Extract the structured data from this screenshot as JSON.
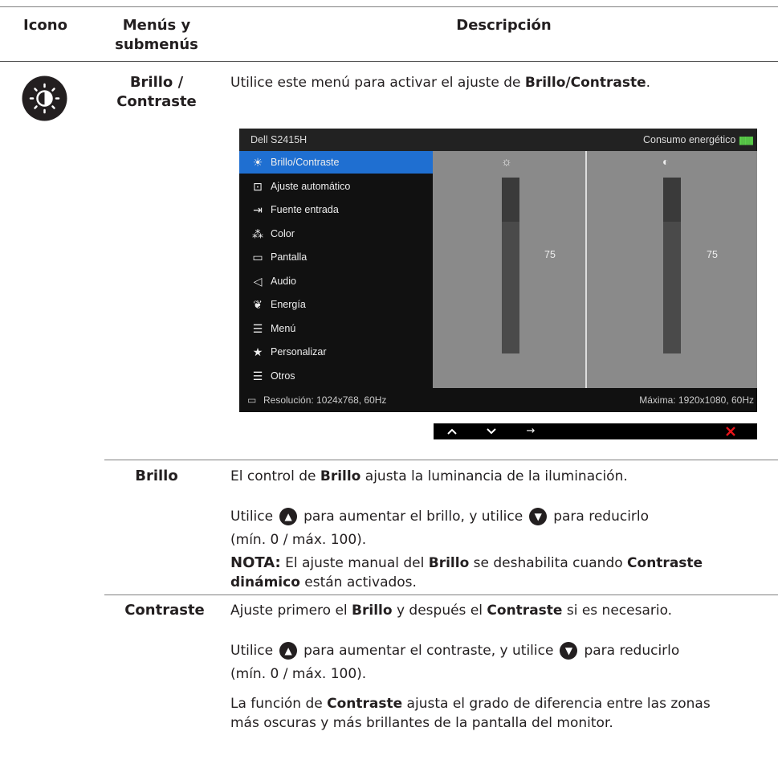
{
  "headers": {
    "icon": "Icono",
    "menus_line1": "Menús y",
    "menus_line2": "submenús",
    "description": "Descripción"
  },
  "main_row": {
    "menu_label_line1": "Brillo /",
    "menu_label_line2": "Contraste",
    "intro_pre": "Utilice este menú para activar el ajuste de ",
    "intro_bold": "Brillo/Contraste",
    "intro_post": "."
  },
  "osd": {
    "model": "Dell S2415H",
    "energy_label": "Consumo energético",
    "energy_meter": "||||||||||||||||||||",
    "menu_items": [
      {
        "icon": "brightness-icon",
        "label": "Brillo/Contraste",
        "selected": true
      },
      {
        "icon": "auto-adjust-icon",
        "label": "Ajuste  automático",
        "selected": false
      },
      {
        "icon": "input-source-icon",
        "label": "Fuente entrada",
        "selected": false
      },
      {
        "icon": "color-icon",
        "label": "Color",
        "selected": false
      },
      {
        "icon": "display-icon",
        "label": "Pantalla",
        "selected": false
      },
      {
        "icon": "audio-icon",
        "label": "Audio",
        "selected": false
      },
      {
        "icon": "energy-icon",
        "label": "Energía",
        "selected": false
      },
      {
        "icon": "menu-icon",
        "label": "Menú",
        "selected": false
      },
      {
        "icon": "star-icon",
        "label": "Personalizar",
        "selected": false
      },
      {
        "icon": "others-icon",
        "label": "Otros",
        "selected": false
      }
    ],
    "brightness_value": "75",
    "contrast_value": "75",
    "brightness_level": 0.75,
    "contrast_level": 0.75,
    "resolution": "Resolución: 1024x768, 60Hz",
    "max_resolution": "Máxima: 1920x1080, 60Hz",
    "nav": {
      "up": "^",
      "down": "v",
      "right": "→",
      "close": "×"
    }
  },
  "brillo_row": {
    "label": "Brillo",
    "line1_pre": "El control de ",
    "line1_bold": "Brillo",
    "line1_post": " ajusta la luminancia de la iluminación.",
    "line2_a": "Utilice",
    "line2_b": "para aumentar el brillo, y utilice",
    "line2_c": "para reducirlo",
    "line3": "(mín. 0 / máx. 100).",
    "note_label": "NOTA:",
    "note_1": " El ajuste manual del ",
    "note_2": "Brillo",
    "note_3": " se deshabilita cuando ",
    "note_4": "Contraste",
    "note_5": "dinámico",
    "note_6": " están activados."
  },
  "contraste_row": {
    "label": "Contraste",
    "line1_a": "Ajuste primero el ",
    "line1_b": "Brillo",
    "line1_c": " y después el ",
    "line1_d": "Contraste",
    "line1_e": " si es necesario.",
    "line2_a": "Utilice",
    "line2_b": "para aumentar el contraste, y utilice",
    "line2_c": "para reducirlo",
    "line3": "(mín. 0 / máx. 100).",
    "line4_a": "La función de ",
    "line4_b": "Contraste",
    "line4_c": " ajusta el grado de diferencia entre las zonas",
    "line5": "más oscuras y más brillantes de la pantalla del monitor."
  }
}
